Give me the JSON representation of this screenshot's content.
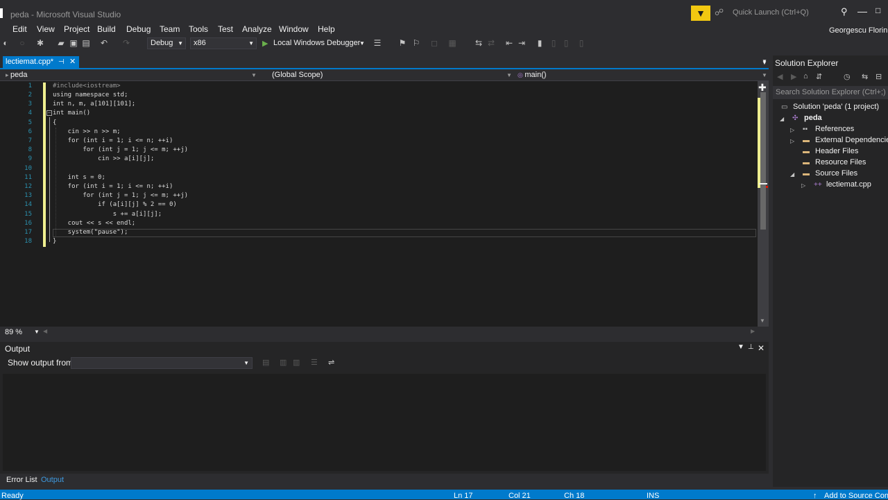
{
  "window": {
    "title": "peda - Microsoft Visual Studio",
    "user": "Georgescu Florin"
  },
  "quick_launch": {
    "placeholder": "Quick Launch (Ctrl+Q)"
  },
  "menu": [
    "Edit",
    "View",
    "Project",
    "Build",
    "Debug",
    "Team",
    "Tools",
    "Test",
    "Analyze",
    "Window",
    "Help"
  ],
  "toolbar": {
    "config": "Debug",
    "platform": "x86",
    "debugger": "Local Windows Debugger"
  },
  "doc_tab": {
    "label": "lectiemat.cpp*"
  },
  "navbar": {
    "project": "peda",
    "scope": "(Global Scope)",
    "member": "main()"
  },
  "editor": {
    "line_numbers": [
      "1",
      "2",
      "3",
      "4",
      "5",
      "6",
      "7",
      "8",
      "9",
      "10",
      "11",
      "12",
      "13",
      "14",
      "15",
      "16",
      "17",
      "18"
    ],
    "lines": [
      "#include<iostream>",
      "using namespace std;",
      "int n, m, a[101][101];",
      "int main()",
      "{",
      "    cin >> n >> m;",
      "    for (int i = 1; i <= n; ++i)",
      "        for (int j = 1; j <= m; ++j)",
      "            cin >> a[i][j];",
      "",
      "    int s = 0;",
      "    for (int i = 1; i <= n; ++i)",
      "        for (int j = 1; j <= m; ++j)",
      "            if (a[i][j] % 2 == 0)",
      "                s += a[i][j];",
      "    cout << s << endl;",
      "    system(\"pause\");",
      "}"
    ],
    "zoom": "89 %"
  },
  "output": {
    "title": "Output",
    "show_from_label": "Show output from:",
    "show_from_value": ""
  },
  "bottom_tabs": [
    "Error List",
    "Output"
  ],
  "solution_explorer": {
    "title": "Solution Explorer",
    "search_placeholder": "Search Solution Explorer (Ctrl+;)",
    "items": [
      {
        "label": "Solution 'peda' (1 project)"
      },
      {
        "label": "peda"
      },
      {
        "label": "References"
      },
      {
        "label": "External Dependencies"
      },
      {
        "label": "Header Files"
      },
      {
        "label": "Resource Files"
      },
      {
        "label": "Source Files"
      },
      {
        "label": "lectiemat.cpp"
      }
    ]
  },
  "status": {
    "state": "Ready",
    "ln": "Ln 17",
    "col": "Col 21",
    "ch": "Ch 18",
    "mode": "INS",
    "source_control": "Add to Source Control"
  }
}
